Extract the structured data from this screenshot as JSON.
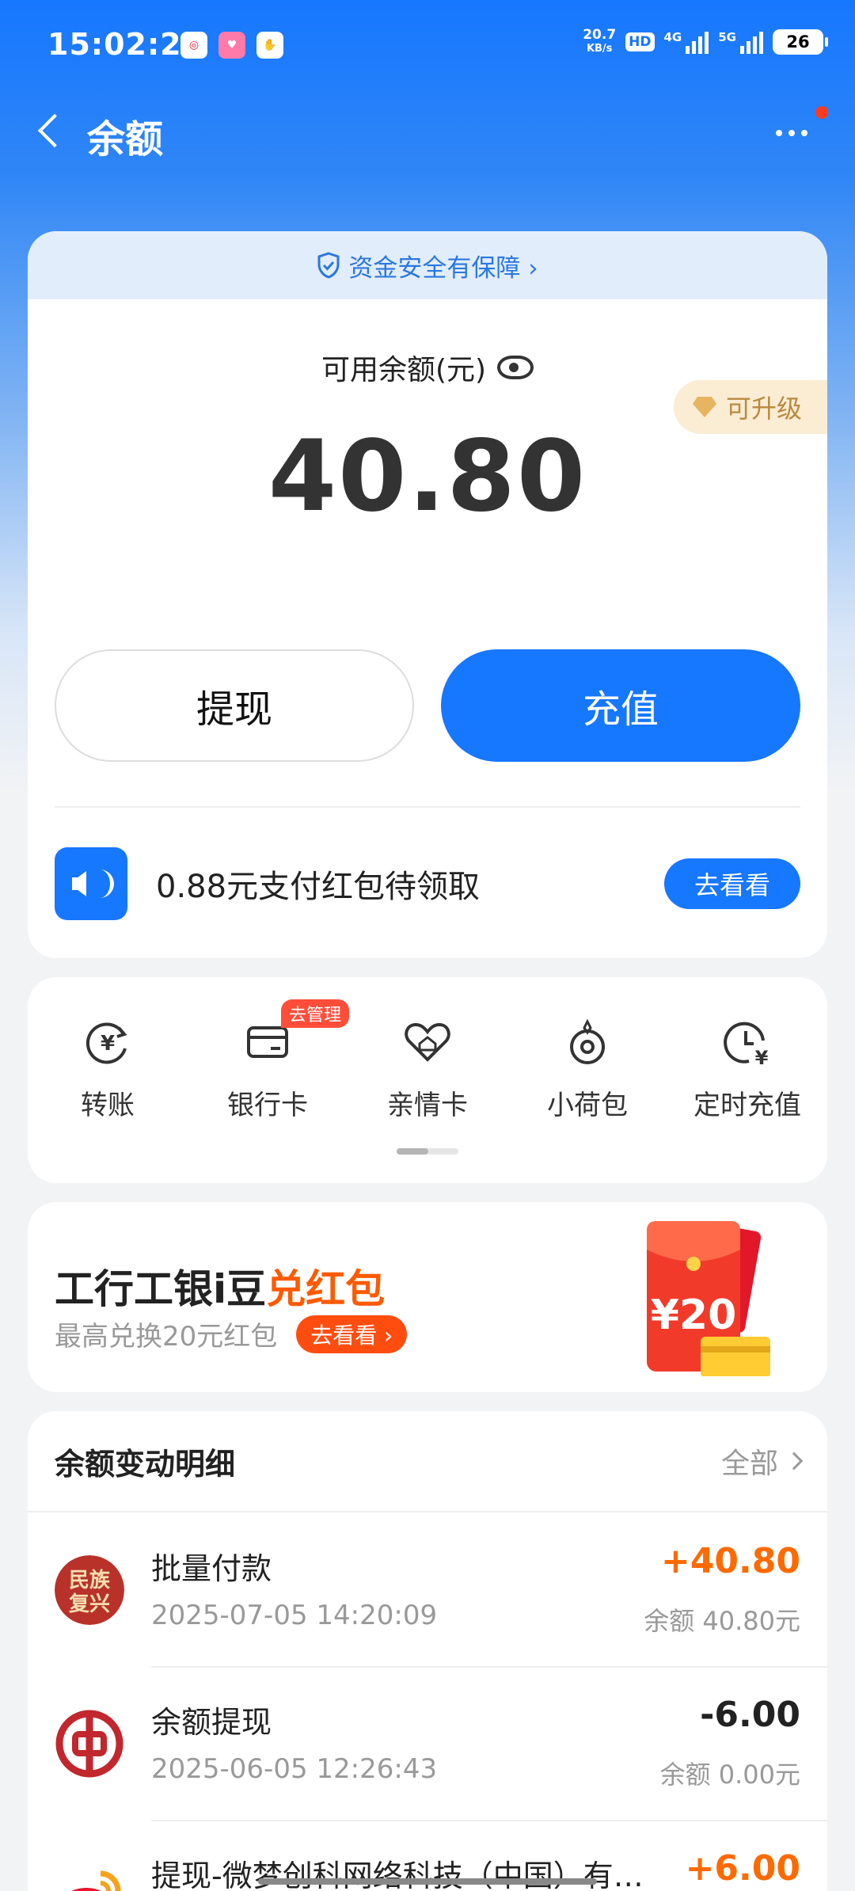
{
  "status_bar": {
    "time": "15:02:28",
    "net_speed_value": "20.7",
    "net_speed_unit": "KB/s",
    "hd_label": "HD",
    "signal_1": "4G",
    "signal_2": "5G",
    "battery": "26"
  },
  "nav": {
    "title": "余额"
  },
  "balance_card": {
    "security_text": "资金安全有保障 ›",
    "balance_label": "可用余额(元)",
    "amount": "40.80",
    "upgrade_label": "可升级",
    "withdraw_label": "提现",
    "recharge_label": "充值",
    "promo_text": "0.88元支付红包待领取",
    "promo_button": "去看看"
  },
  "quick_actions": [
    {
      "label": "转账",
      "icon": "yuan-transfer-icon"
    },
    {
      "label": "银行卡",
      "icon": "bank-card-icon",
      "badge": "去管理"
    },
    {
      "label": "亲情卡",
      "icon": "heart-card-icon"
    },
    {
      "label": "小荷包",
      "icon": "purse-icon"
    },
    {
      "label": "定时充值",
      "icon": "clock-yuan-icon"
    }
  ],
  "banner": {
    "title_main": "工行工银i豆",
    "title_highlight": "兑红包",
    "subtitle": "最高兑换20元红包",
    "button": "去看看 ›",
    "envelope_amount": "¥20"
  },
  "history": {
    "title": "余额变动明细",
    "all_label": "全部",
    "rows": [
      {
        "name": "批量付款",
        "date": "2025-07-05 14:20:09",
        "amount": "+40.80",
        "balance": "余额 40.80元",
        "logo_text": "民族复兴"
      },
      {
        "name": "余额提现",
        "date": "2025-06-05 12:26:43",
        "amount": "-6.00",
        "balance": "余额 0.00元",
        "logo_text": ""
      },
      {
        "name": "提现-微梦创科网络科技（中国）有…",
        "date": "",
        "amount": "+6.00",
        "balance": "",
        "logo_text": ""
      }
    ]
  },
  "colors": {
    "primary": "#1677ff",
    "positive": "#ff6a00",
    "badge": "#ff4d3a"
  }
}
